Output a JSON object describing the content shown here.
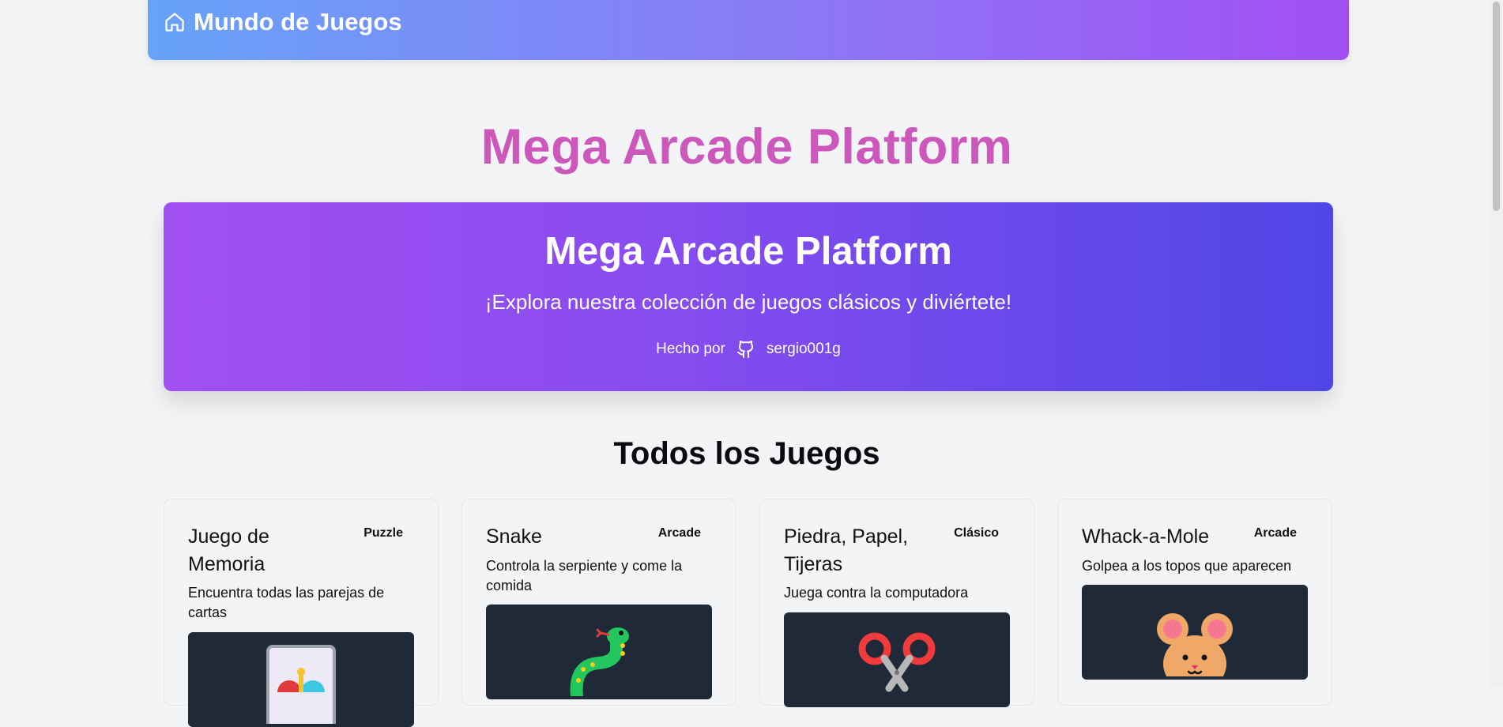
{
  "navbar": {
    "brand": "Mundo de Juegos",
    "gradient": [
      "#67a3f8",
      "#a24ff2"
    ],
    "icon": "home-icon"
  },
  "page": {
    "title": "Mega Arcade Platform",
    "title_color": "#cc58bc"
  },
  "hero": {
    "title": "Mega Arcade Platform",
    "subtitle": "¡Explora nuestra colección de juegos clásicos y diviértete!",
    "made_by": "Hecho por",
    "author": "sergio001g",
    "author_icon": "github-icon",
    "gradient": [
      "#a24ff2",
      "#4f46e5"
    ]
  },
  "games": {
    "heading": "Todos los Juegos",
    "items": [
      {
        "title": "Juego de Memoria",
        "category": "Puzzle",
        "description": "Encuentra todas las parejas de cartas",
        "icon": "memory-card-icon"
      },
      {
        "title": "Snake",
        "category": "Arcade",
        "description": "Controla la serpiente y come la comida",
        "icon": "snake-icon"
      },
      {
        "title": "Piedra, Papel, Tijeras",
        "category": "Clásico",
        "description": "Juega contra la computadora",
        "icon": "scissors-icon"
      },
      {
        "title": "Whack-a-Mole",
        "category": "Arcade",
        "description": "Golpea a los topos que aparecen",
        "icon": "mouse-icon"
      }
    ]
  }
}
